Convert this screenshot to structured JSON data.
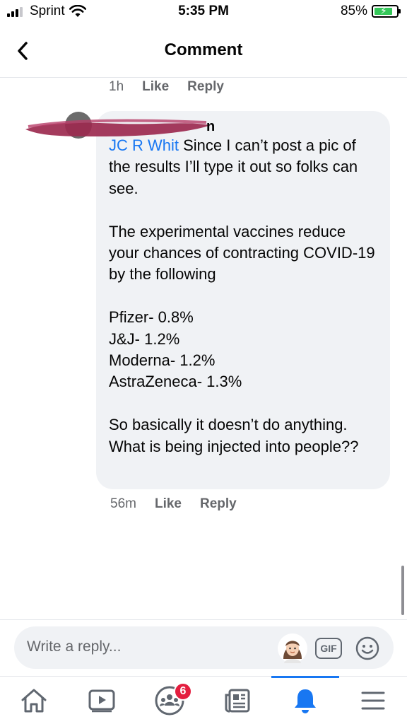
{
  "status_bar": {
    "carrier": "Sprint",
    "time": "5:35 PM",
    "battery": "85%",
    "battery_level": 0.85,
    "icons": [
      "cellular-signal-icon",
      "wifi-icon",
      "battery-charging-icon"
    ]
  },
  "header": {
    "title": "Comment",
    "back_icon": "chevron-left-icon"
  },
  "previous_comment_meta": {
    "time": "1h",
    "like": "Like",
    "reply": "Reply"
  },
  "comment": {
    "author_fragment": "n",
    "mention": "JC R Whit",
    "first_line_rest": " Since I can’t post a pic of the results I’ll type it out so folks can see.",
    "paragraph_2": "The experimental vaccines reduce your chances of contracting COVID-19 by the following",
    "list": [
      "Pfizer- 0.8%",
      "J&J- 1.2%",
      "Moderna- 1.2%",
      "AstraZeneca- 1.3%"
    ],
    "paragraph_4": "So basically it doesn’t do anything. What is being injected into people??",
    "time": "56m",
    "like": "Like",
    "reply": "Reply"
  },
  "composer": {
    "placeholder": "Write a reply...",
    "gif_label": "GIF",
    "icons": [
      "avatar-icon",
      "gif-icon",
      "emoji-icon"
    ]
  },
  "tabbar": {
    "items": [
      {
        "name": "home",
        "icon": "home-icon"
      },
      {
        "name": "watch",
        "icon": "video-icon"
      },
      {
        "name": "groups",
        "icon": "groups-icon",
        "badge": "6"
      },
      {
        "name": "news",
        "icon": "news-feed-icon"
      },
      {
        "name": "notifications",
        "icon": "bell-icon",
        "active": true
      },
      {
        "name": "menu",
        "icon": "menu-icon"
      }
    ]
  },
  "colors": {
    "accent": "#1877f2",
    "bubble": "#f0f2f5",
    "meta_text": "#65676b",
    "badge": "#e41e3f",
    "redaction": "#9c2a4f"
  }
}
